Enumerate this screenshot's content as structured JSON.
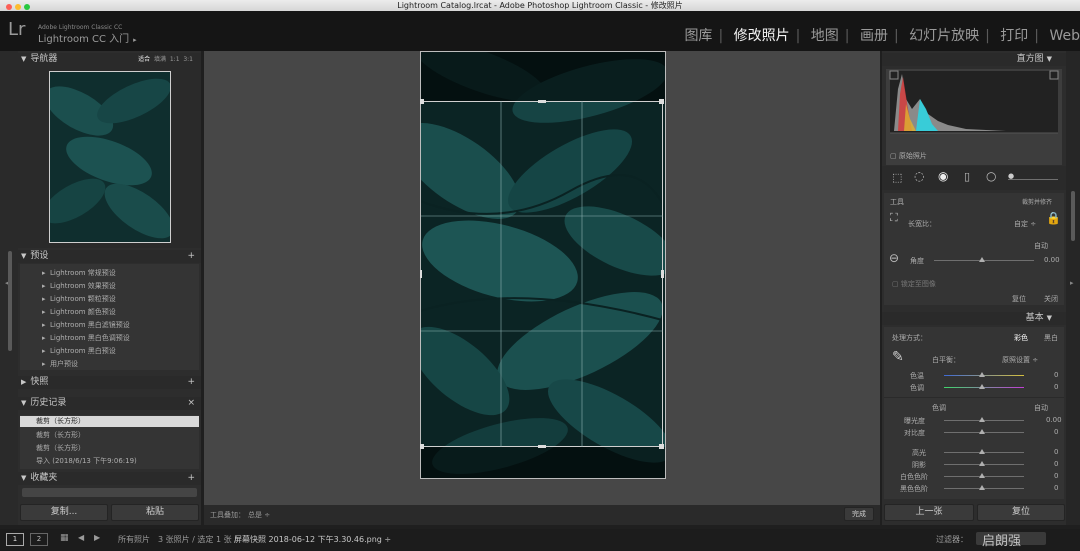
{
  "window": {
    "title": "Lightroom Catalog.lrcat - Adobe Photoshop Lightroom Classic - 修改照片"
  },
  "identity": {
    "logo": "Lr",
    "small": "Adobe Lightroom Classic CC",
    "title": "Lightroom CC 入门"
  },
  "modules": [
    "图库",
    "修改照片",
    "地图",
    "画册",
    "幻灯片放映",
    "打印",
    "Web"
  ],
  "active_module": "修改照片",
  "navigator": {
    "title": "导航器",
    "zoom": [
      "适合",
      "填满",
      "1:1",
      "3:1"
    ]
  },
  "presets": {
    "title": "预设",
    "items": [
      "Lightroom 常规预设",
      "Lightroom 效果预设",
      "Lightroom 颗粒预设",
      "Lightroom 颜色预设",
      "Lightroom 黑白滤镜预设",
      "Lightroom 黑白色调预设",
      "Lightroom 黑白预设",
      "用户预设"
    ]
  },
  "snapshots": {
    "title": "快照"
  },
  "history": {
    "title": "历史记录",
    "items": [
      "裁剪（长方形）",
      "裁剪（长方形）",
      "裁剪（长方形）",
      "导入 (2018/6/13 下午9:06:19)"
    ]
  },
  "collections": {
    "title": "收藏夹"
  },
  "left_buttons": {
    "copy": "复制...",
    "paste": "粘贴"
  },
  "histogram": {
    "title": "直方图",
    "original": "原始照片"
  },
  "crop": {
    "tool_label": "工具",
    "crop_reset": "裁剪并修齐",
    "aspect_label": "长宽比：",
    "aspect_value": "自定 ÷",
    "auto": "自动",
    "angle_label": "角度",
    "angle_value": "0.00",
    "constrain": "锁定至图像",
    "reset": "复位",
    "close": "关闭"
  },
  "basic": {
    "title": "基本",
    "treatment_label": "处理方式：",
    "color": "彩色",
    "bw": "黑白",
    "wb_label": "白平衡：",
    "wb_value": "原照设置 ÷",
    "temp": "色温",
    "tint": "色调",
    "tone": "色调",
    "auto": "自动",
    "exposure": "曝光度",
    "contrast": "对比度",
    "highlights": "高光",
    "shadows": "阴影",
    "whites": "白色色阶",
    "blacks": "黑色色阶",
    "values": {
      "temp": "0",
      "tint": "0",
      "exposure": "0.00",
      "contrast": "0",
      "highlights": "0",
      "shadows": "0",
      "whites": "0",
      "blacks": "0"
    }
  },
  "right_buttons": {
    "previous": "上一张",
    "reset": "复位"
  },
  "toolbar": {
    "overlay_label": "工具叠加：",
    "overlay_value": "总是 ÷",
    "done": "完成"
  },
  "filmstrip": {
    "page1": "1",
    "page2": "2",
    "source": "所有照片",
    "info": "3 张照片 / 选定 1 张 /",
    "filename": "屏幕快照 2018-06-12 下午3.30.46.png ÷",
    "filter": "过滤器：",
    "watermark": "启朗强"
  },
  "colors": {
    "accent": "#f2f2f2",
    "panel": "#2d2d2d",
    "canvas": "#474747",
    "photo": "#123a3a"
  }
}
